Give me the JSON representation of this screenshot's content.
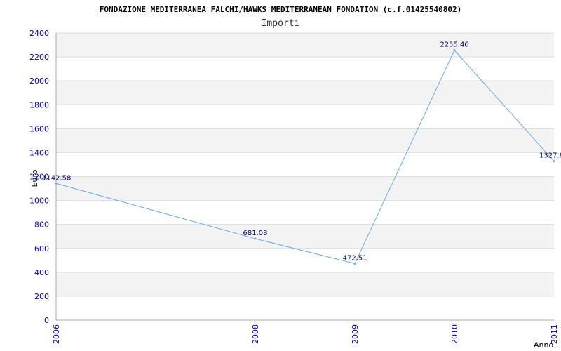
{
  "chart_data": {
    "type": "line",
    "title": "FONDAZIONE MEDITERRANEA FALCHI/HAWKS MEDITERRANEAN FONDATION (c.f.01425540802)",
    "subtitle": "Importi",
    "xlabel": "Anno",
    "ylabel": "Euro",
    "x": [
      "2006",
      "2008",
      "2009",
      "2010",
      "2011"
    ],
    "series": [
      {
        "values": [
          1142.58,
          681.08,
          472.51,
          2255.46,
          1327.8
        ]
      }
    ],
    "data_labels": [
      "1142.58",
      "681.08",
      "472.51",
      "2255.46",
      "1327.8"
    ],
    "ylim": [
      0,
      2400
    ],
    "yticks": [
      0,
      200,
      400,
      600,
      800,
      1000,
      1200,
      1400,
      1600,
      1800,
      2000,
      2200,
      2400
    ],
    "grid": "horizontal alternating bands",
    "legend": "none",
    "colors": {
      "line": "#66aaee",
      "band": "#f3f3f3",
      "gridline": "#dddddd",
      "tick_text": "#0000cc",
      "data_label": "#000066"
    }
  }
}
